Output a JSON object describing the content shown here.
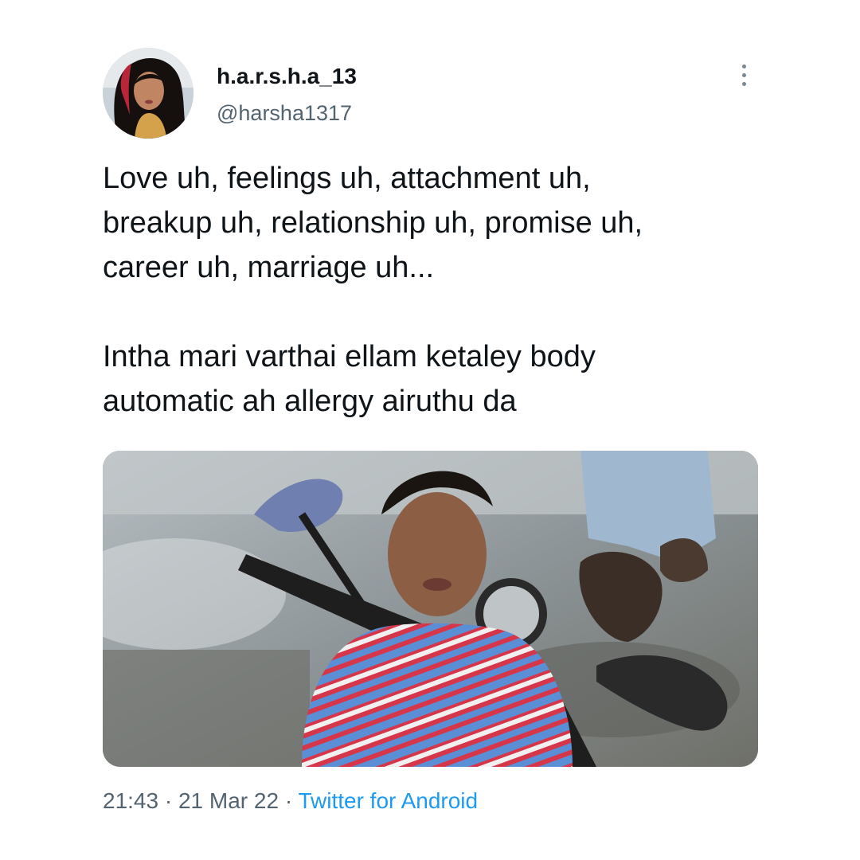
{
  "tweet": {
    "display_name": "h.a.r.s.h.a_13",
    "handle": "@harsha1317",
    "text_lines": [
      "Love uh, feelings uh, attachment uh,",
      "breakup uh, relationship uh, promise uh,",
      "career uh, marriage uh...",
      "Intha mari varthai ellam ketaley body",
      "automatic ah allergy airuthu da"
    ],
    "time": "21:43",
    "separator": "·",
    "date": "21 Mar 22",
    "source": "Twitter for Android",
    "more_icon": "more-vertical-icon"
  },
  "colors": {
    "text_primary": "#0f1419",
    "text_secondary": "#536471",
    "link_blue": "#1d9bf0",
    "background": "#ffffff"
  }
}
